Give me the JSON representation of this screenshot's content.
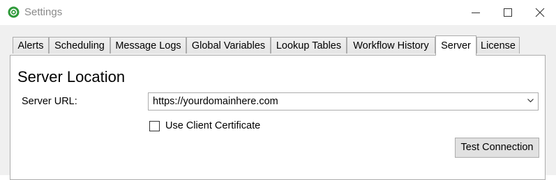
{
  "window": {
    "title": "Settings",
    "app_icon": "settings-app-icon",
    "controls": [
      "minimize-icon",
      "maximize-icon",
      "close-icon"
    ]
  },
  "tabs": [
    {
      "label": "Alerts",
      "active": false
    },
    {
      "label": "Scheduling",
      "active": false
    },
    {
      "label": "Message Logs",
      "active": false
    },
    {
      "label": "Global Variables",
      "active": false
    },
    {
      "label": "Lookup Tables",
      "active": false
    },
    {
      "label": "Workflow History",
      "active": false
    },
    {
      "label": "Server",
      "active": true
    },
    {
      "label": "License",
      "active": false
    }
  ],
  "server": {
    "section_title": "Server Location",
    "url_label": "Server URL:",
    "url_value": "https://yourdomainhere.com",
    "client_cert_label": "Use Client Certificate",
    "client_cert_checked": false,
    "test_button": "Test Connection"
  },
  "colors": {
    "tab_border": "#acacac",
    "client_bg": "#f0f0f0",
    "button_bg": "#e1e1e1",
    "app_icon_green": "#2f9a3a"
  }
}
